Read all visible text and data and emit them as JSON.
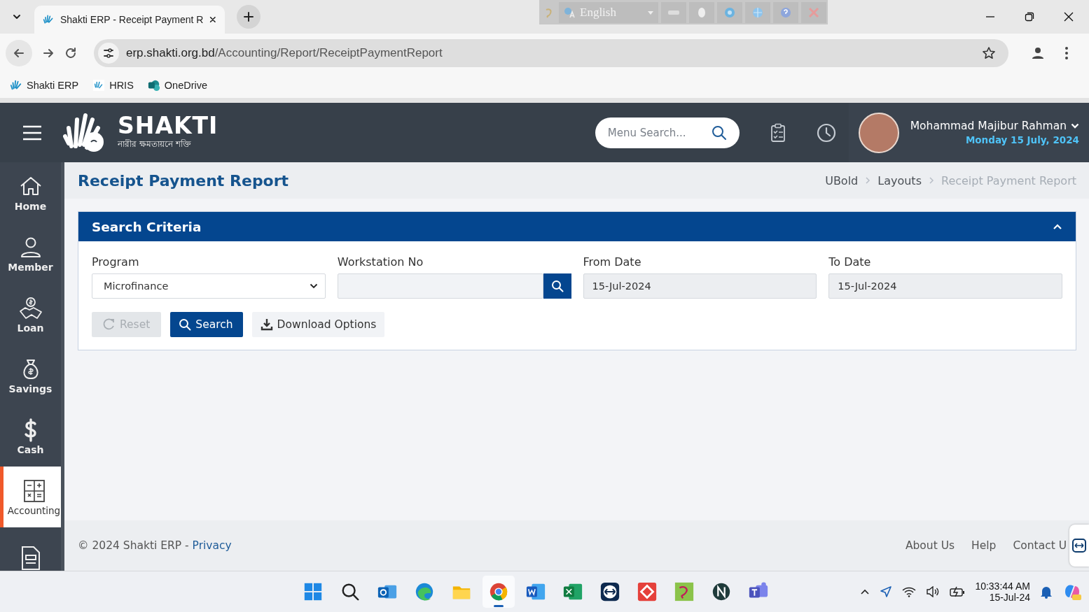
{
  "browser": {
    "tab_title": "Shakti ERP - Receipt Payment R",
    "url_host": "erp.shakti.org.bd",
    "url_path": "/Accounting/Report/ReceiptPaymentReport",
    "bookmarks": [
      {
        "label": "Shakti ERP"
      },
      {
        "label": "HRIS"
      },
      {
        "label": "OneDrive"
      }
    ]
  },
  "language_bar": {
    "language": "English"
  },
  "header": {
    "logo_name": "SHAKTI",
    "logo_tagline": "নারীর ক্ষমতায়নে শক্তি",
    "search": {
      "placeholder": "Menu Search..."
    },
    "user_name": "Mohammad Majibur Rahman",
    "date": "Monday 15 July, 2024"
  },
  "sidebar": {
    "items": [
      {
        "label": "Home",
        "selected": false
      },
      {
        "label": "Member",
        "selected": false
      },
      {
        "label": "Loan",
        "selected": false
      },
      {
        "label": "Savings",
        "selected": false
      },
      {
        "label": "Cash",
        "selected": false
      },
      {
        "label": "Accounting",
        "selected": true
      },
      {
        "selected": false
      }
    ]
  },
  "page_title": "Receipt Payment Report",
  "breadcrumbs": [
    {
      "label": "UBold",
      "current": false
    },
    {
      "label": "Layouts",
      "current": false
    },
    {
      "label": "Receipt Payment Report",
      "current": true
    }
  ],
  "panel": {
    "title": "Search Criteria",
    "expanded": true,
    "fields": [
      {
        "kind": "select",
        "label": "Program",
        "value": "Microfinance"
      },
      {
        "kind": "lookup",
        "label": "Workstation No"
      },
      {
        "kind": "date",
        "label": "From Date",
        "value": "15-Jul-2024"
      },
      {
        "kind": "date",
        "label": "To Date",
        "value": "15-Jul-2024"
      }
    ],
    "buttons": [
      {
        "kind": "reset",
        "label": "Reset",
        "disabled": true
      },
      {
        "kind": "search",
        "label": "Search",
        "disabled": false
      },
      {
        "kind": "download",
        "label": "Download Options",
        "disabled": false
      }
    ]
  },
  "footer": {
    "copyright": "© 2024 Shakti ERP - ",
    "privacy_link": "Privacy",
    "links": [
      {
        "label": "About Us"
      },
      {
        "label": "Help"
      },
      {
        "label": "Contact U"
      }
    ]
  },
  "taskbar": {
    "apps": [
      {
        "selected": false
      },
      {
        "selected": false
      },
      {
        "selected": false
      },
      {
        "selected": false
      },
      {
        "selected": false
      },
      {
        "selected": true
      },
      {
        "selected": false
      },
      {
        "selected": false
      },
      {
        "selected": false
      },
      {
        "selected": false
      },
      {
        "selected": false
      },
      {
        "selected": false
      },
      {
        "selected": false
      }
    ],
    "time": "10:33:44 AM",
    "date": "15-Jul-24"
  }
}
